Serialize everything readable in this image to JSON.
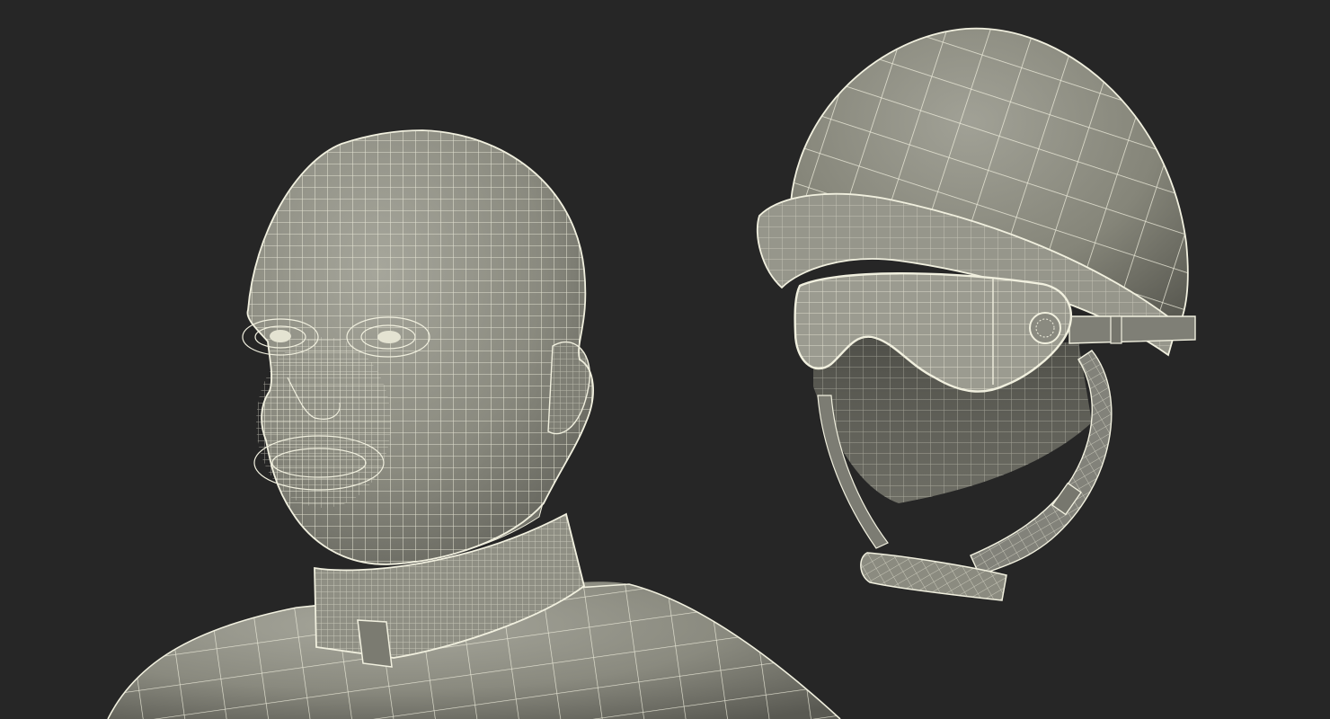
{
  "scene": {
    "subjects": [
      {
        "id": "jockey-head",
        "kind": "head-and-torso-wireframe"
      },
      {
        "id": "jockey-helmet",
        "kind": "helmet-with-goggles-wireframe"
      }
    ]
  },
  "colors": {
    "background": "#262626",
    "surface": "#8d8d82",
    "surface_light": "#a3a398",
    "surface_dark": "#5e5e56",
    "wire": "#f1f0df"
  }
}
